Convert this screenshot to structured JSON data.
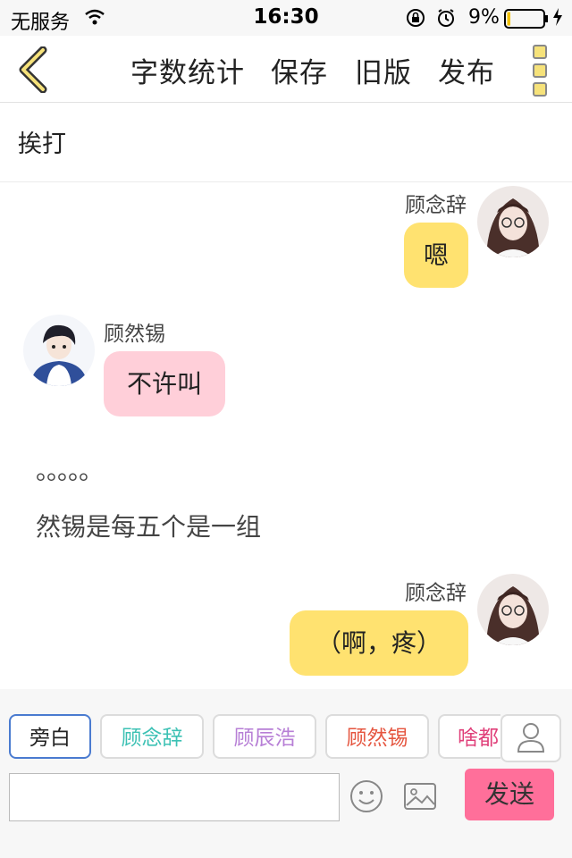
{
  "status_bar": {
    "carrier": "无服务",
    "time": "16:30",
    "battery_pct": "9%",
    "battery_level": 0.09
  },
  "nav": {
    "word_count": "字数统计",
    "save": "保存",
    "old_version": "旧版",
    "publish": "发布"
  },
  "chapter_title": "挨打",
  "messages": [
    {
      "speaker": "顾念辞",
      "text": "嗯",
      "side": "right",
      "bubble_color": "#ffe270"
    },
    {
      "speaker": "顾然锡",
      "text": "不许叫",
      "side": "left",
      "bubble_color": "#ffcfd9"
    },
    {
      "type": "narration",
      "text": "。。。。。"
    },
    {
      "type": "narration",
      "text": "然锡是每五个是一组"
    },
    {
      "speaker": "顾念辞",
      "text": "（啊，疼）",
      "side": "right",
      "bubble_color": "#ffe270"
    }
  ],
  "roles": [
    {
      "label": "旁白",
      "color": "#222222",
      "active": true
    },
    {
      "label": "顾念辞",
      "color": "#3cc1b4",
      "active": false
    },
    {
      "label": "顾辰浩",
      "color": "#b77fd6",
      "active": false
    },
    {
      "label": "顾然锡",
      "color": "#e5553f",
      "active": false
    },
    {
      "label": "啥都",
      "color": "#e0407a",
      "active": false
    }
  ],
  "input": {
    "value": "",
    "placeholder": ""
  },
  "send_label": "发送",
  "colors": {
    "accent_pink": "#ff6f9a",
    "accent_yellow": "#ffe270"
  }
}
